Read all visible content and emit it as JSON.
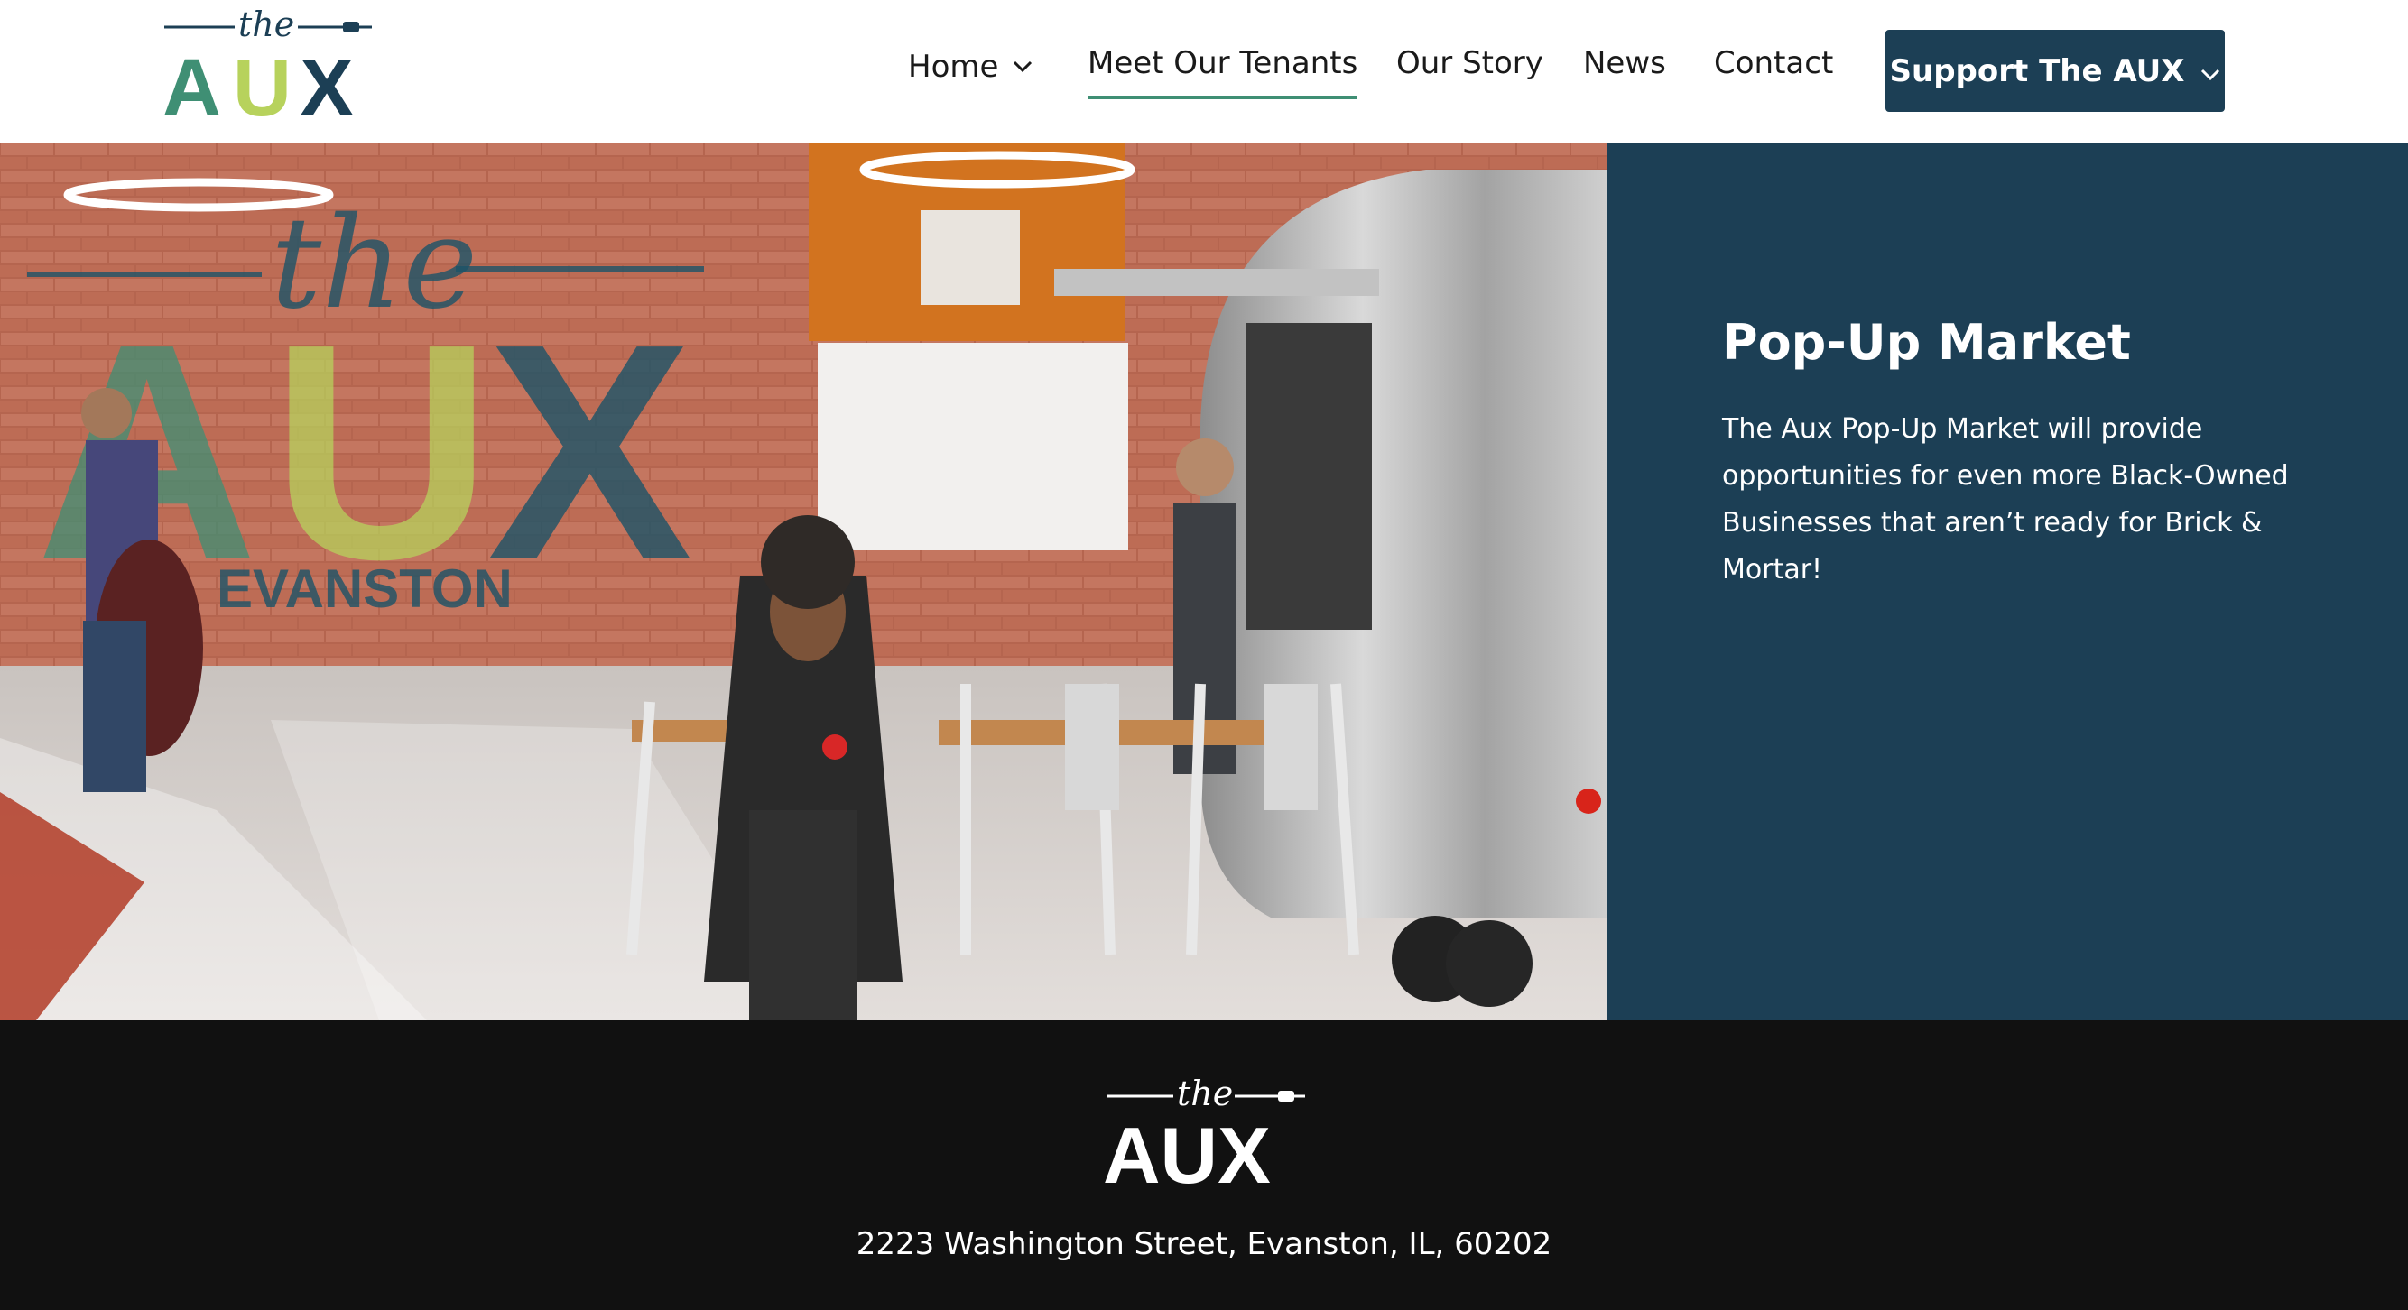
{
  "brand": {
    "logo_small": "the",
    "logo_big": "AUX"
  },
  "nav": {
    "home": "Home",
    "tenants": "Meet Our Tenants",
    "story": "Our Story",
    "news": "News",
    "contact": "Contact",
    "support": "Support The AUX",
    "chevron_icon": "chevron-down-icon"
  },
  "hero": {
    "image_alt": "Rendering of The Aux interior",
    "wall_mural": {
      "small": "the",
      "big": "AUX",
      "city": "EVANSTON"
    }
  },
  "panel": {
    "title": "Pop-Up Market",
    "text": "The Aux Pop-Up Market will provide opportunities for even more Black-Owned Businesses that aren’t ready for Brick & Mortar!"
  },
  "footer": {
    "logo_small": "the",
    "logo_big": "AUX",
    "address": "2223 Washington Street, Evanston, IL, 60202"
  },
  "colors": {
    "navy": "#1c3f55",
    "green": "#3f8f74",
    "lime": "#b7d25c",
    "footer_bg": "#111111"
  }
}
